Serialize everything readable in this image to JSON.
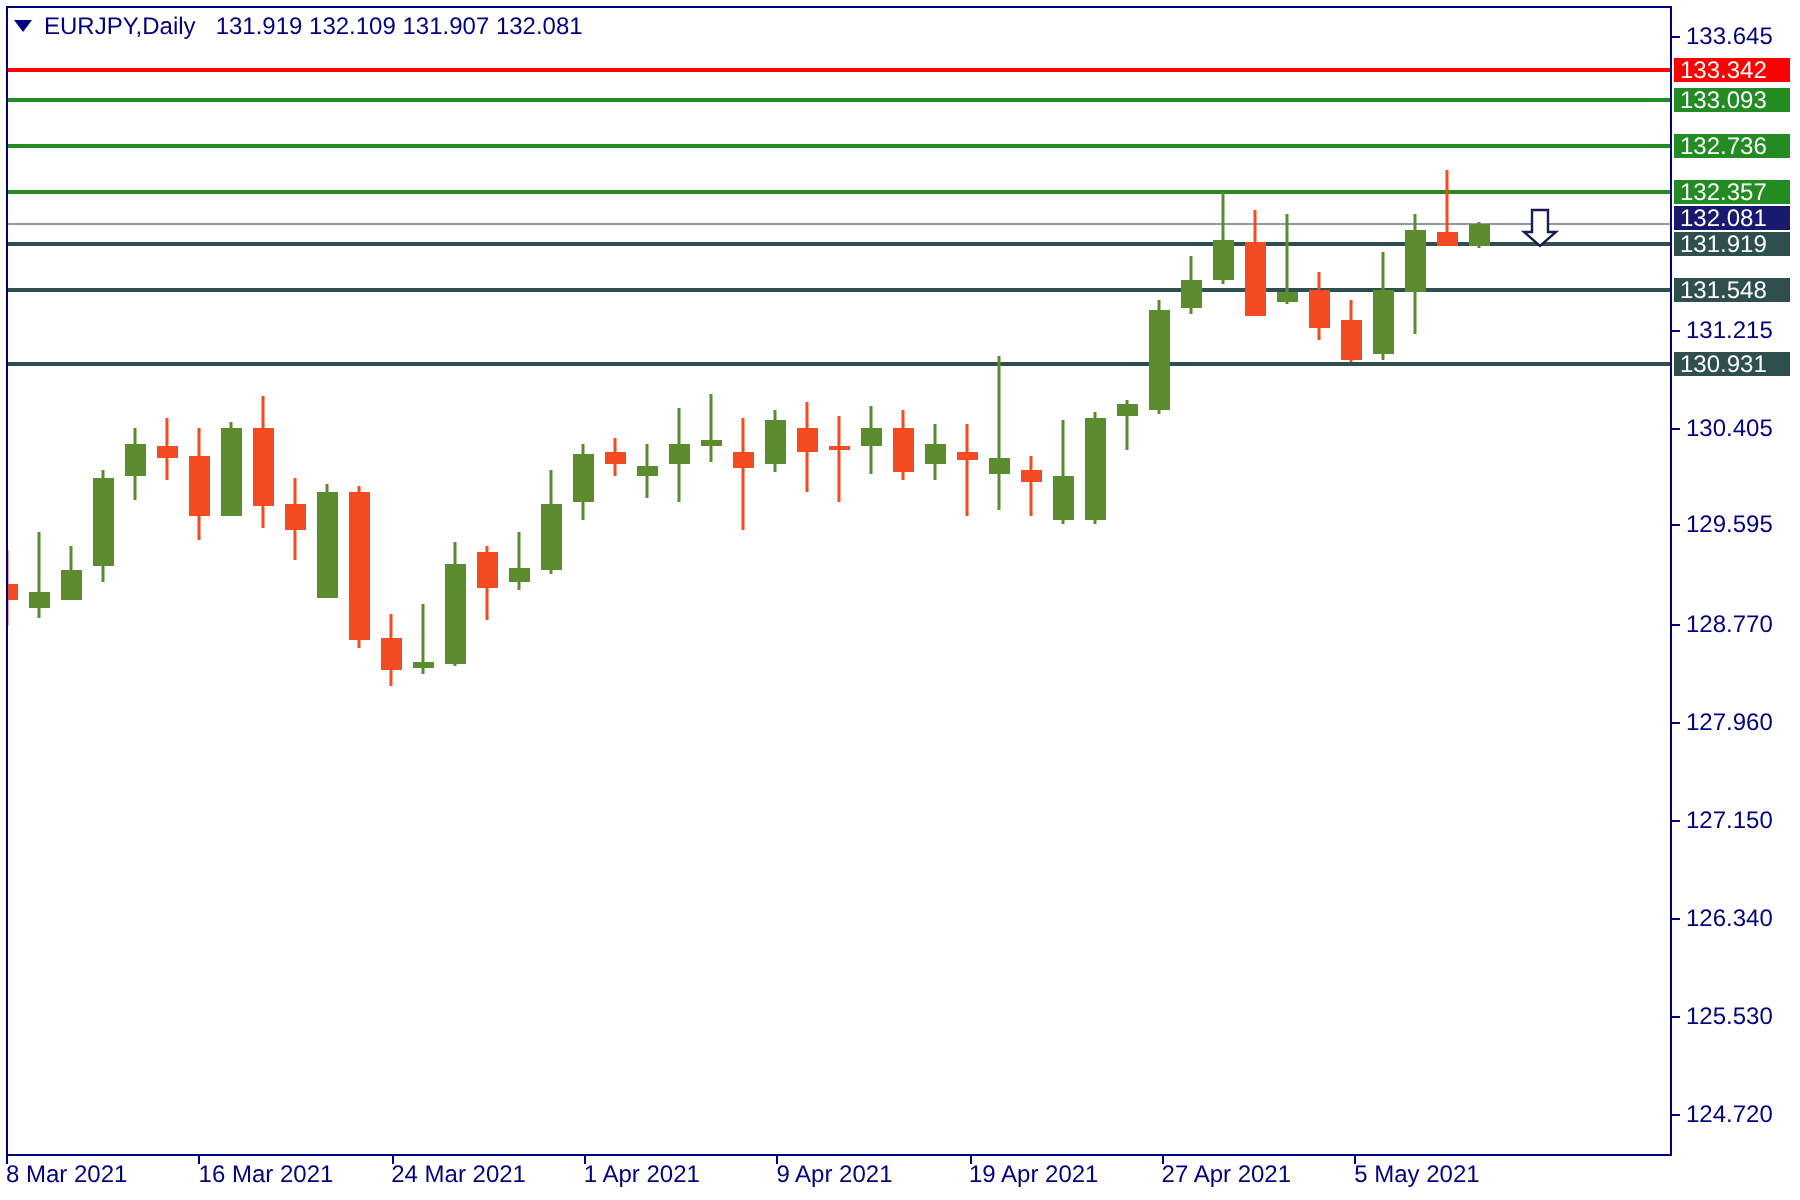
{
  "header": {
    "symbol": "EURJPY,Daily",
    "ohlc": "131.919 132.109 131.907 132.081"
  },
  "levels": [
    {
      "label": "133.342",
      "color": "#ff0000",
      "kind": "level"
    },
    {
      "label": "133.093",
      "color": "#228b22",
      "kind": "level"
    },
    {
      "label": "132.736",
      "color": "#228b22",
      "kind": "level"
    },
    {
      "label": "132.357",
      "color": "#228b22",
      "kind": "level"
    },
    {
      "label": "132.081",
      "color": "#191970",
      "kind": "bid"
    },
    {
      "label": "131.919",
      "color": "#2f4f4f",
      "kind": "level"
    },
    {
      "label": "131.548",
      "color": "#2f4f4f",
      "kind": "level"
    },
    {
      "label": "130.931",
      "color": "#2f4f4f",
      "kind": "level"
    }
  ],
  "price_axis": [
    "133.645",
    "131.215",
    "130.405",
    "129.595",
    "128.770",
    "127.960",
    "127.150",
    "126.340",
    "125.530",
    "124.720"
  ],
  "date_axis": [
    "8 Mar 2021",
    "16 Mar 2021",
    "24 Mar 2021",
    "1 Apr 2021",
    "9 Apr 2021",
    "19 Apr 2021",
    "27 Apr 2021",
    "5 May 2021"
  ]
}
